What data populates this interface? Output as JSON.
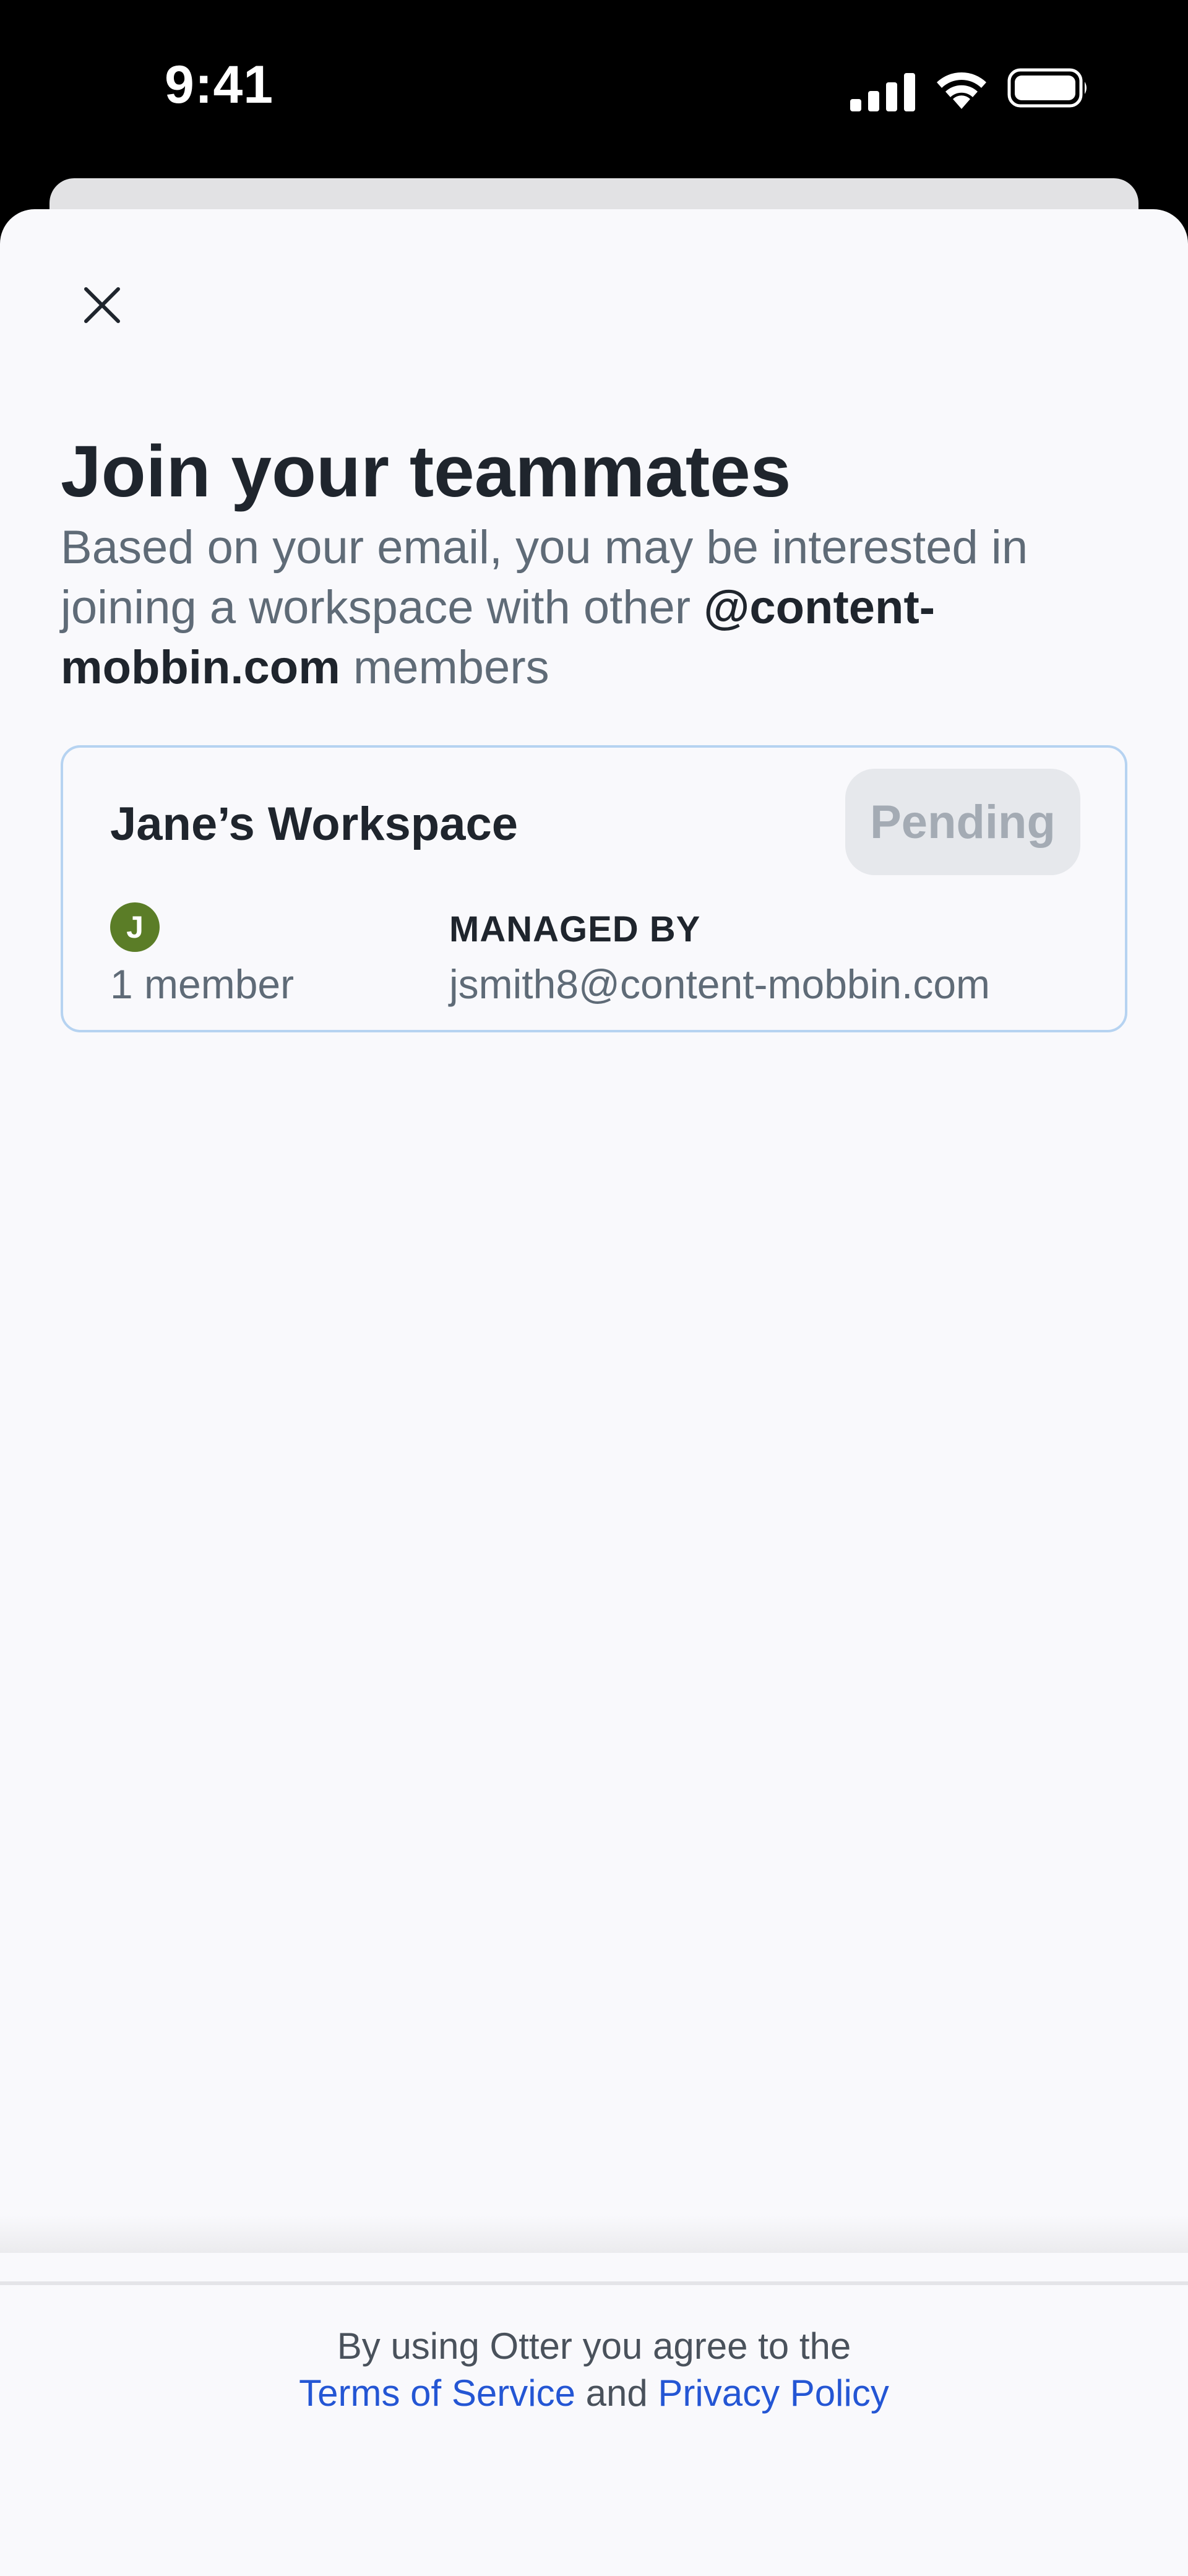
{
  "status_bar": {
    "time": "9:41",
    "icons": [
      "signal-icon",
      "wifi-icon",
      "battery-icon"
    ]
  },
  "sheet": {
    "close_icon": "close-icon",
    "title": "Join your teammates",
    "subtitle": {
      "prefix": "Based on your email, you may be interested in joining a workspace with other ",
      "domain": "@content-mobbin.com",
      "suffix": " members"
    }
  },
  "workspace": {
    "name": "Jane’s Workspace",
    "status": "Pending",
    "avatar_initial": "J",
    "member_count": "1 member",
    "managed_label": "MANAGED BY",
    "managed_email": "jsmith8@content-mobbin.com"
  },
  "footer": {
    "line1": "By using Otter you agree to the",
    "terms": "Terms of Service",
    "and": "and",
    "privacy": "Privacy Policy"
  },
  "colors": {
    "background": "#f9f9fc",
    "text_primary": "#1f252d",
    "text_secondary": "#5f6b77",
    "card_border": "#b6d3f1",
    "pending_bg": "#e6e8ec",
    "pending_text": "#a4abb4",
    "avatar": "#5b7d27",
    "link": "#2456d4"
  }
}
